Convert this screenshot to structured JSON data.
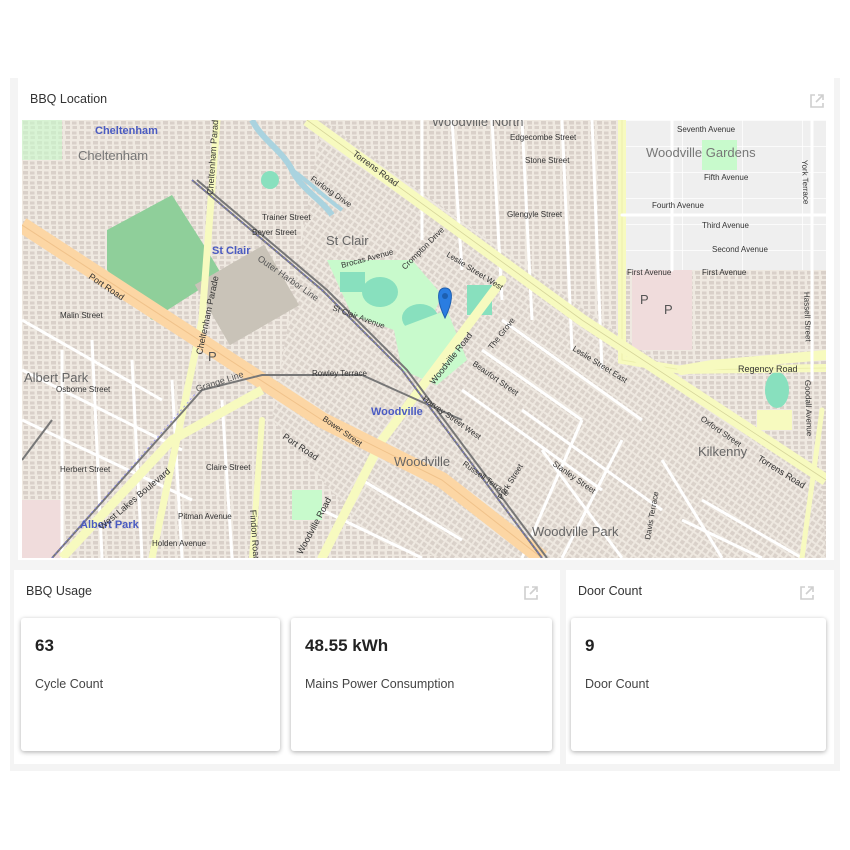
{
  "map_panel": {
    "title": "BBQ Location",
    "labels": {
      "cheltenham_station": "Cheltenham",
      "cheltenham": "Cheltenham",
      "st_clair_station": "St Clair",
      "st_clair": "St Clair",
      "albert_park": "Albert Park",
      "albert_park_station": "Albert Park",
      "woodville": "Woodville",
      "woodville_station": "Woodville",
      "woodville_north": "Woodville North",
      "woodville_gardens": "Woodville Gardens",
      "woodville_park": "Woodville Park",
      "kilkenny": "Kilkenny",
      "port_road": "Port Road",
      "port_road_2": "Port Road",
      "torrens_road": "Torrens Road",
      "torrens_road_2": "Torrens Road",
      "woodville_road": "Woodville Road",
      "woodville_road_2": "Woodville Road",
      "cheltenham_parade": "Cheltenham Parade",
      "cheltenham_parade_2": "Cheltenham Parade",
      "regency_road": "Regency Road",
      "west_lakes_boulevard": "West Lakes Boulevard",
      "grange_line": "Grange Line",
      "outer_harbor_line": "Outer Harbor Line",
      "findon_road": "Findon Road",
      "malin_street": "Malin Street",
      "osborne_street": "Osborne Street",
      "herbert_street": "Herbert Street",
      "claire_street": "Claire Street",
      "pitman_avenue": "Pitman Avenue",
      "holden_avenue": "Holden Avenue",
      "seventh_avenue": "Seventh Avenue",
      "fifth_avenue": "Fifth Avenue",
      "fourth_avenue": "Fourth Avenue",
      "third_avenue": "Third Avenue",
      "second_avenue": "Second Avenue",
      "first_avenue": "First Avenue",
      "first_avenue_2": "First Avenue",
      "edgecombe_street": "Edgecombe Street",
      "stone_street": "Stone Street",
      "glengyle_street": "Glengyle Street",
      "leslie_street_west": "Leslie Street West",
      "leslie_street_east": "Leslie Street East",
      "st_clair_avenue": "St Clair Avenue",
      "brocas_avenue": "Brocas Avenue",
      "beyer_street": "Beyer Street",
      "trainer_street": "Trainer Street",
      "crompton_drive": "Crompton Drive",
      "furlong_drive": "Furlong Drive",
      "rowley_terrace": "Rowley Terrace",
      "bower_street": "Bower Street",
      "the_grove": "The Grove",
      "beaufort_street": "Beaufort Street",
      "park_street": "Park Street",
      "stanley_street": "Stanley Street",
      "harvey_street_west": "Harvey Street West",
      "russell_terrace": "Russell Terrace",
      "davis_terrace": "Davis Terrace",
      "oxford_street": "Oxford Street",
      "goodall_avenue": "Goodall Avenue",
      "york_terrace": "York Terrace",
      "hassell_street": "Hassell Street"
    }
  },
  "usage_panel": {
    "title": "BBQ Usage",
    "cards": [
      {
        "value": "63",
        "label": "Cycle Count"
      },
      {
        "value": "48.55 kWh",
        "label": "Mains Power Consumption"
      }
    ]
  },
  "door_panel": {
    "title": "Door Count",
    "card": {
      "value": "9",
      "label": "Door Count"
    }
  },
  "colors": {
    "map_land": "#efe9e1",
    "map_building": "#d9d0c9",
    "map_park": "#c8facc",
    "map_sports": "#88e0be",
    "map_primary_road": "#fcd6a4",
    "map_secondary_road": "#f7fabf",
    "map_rail": "#777777",
    "map_water": "#aad3df",
    "marker": "#2a7de1"
  },
  "icons": {
    "expand": "external-link-icon",
    "marker": "map-pin-icon"
  }
}
